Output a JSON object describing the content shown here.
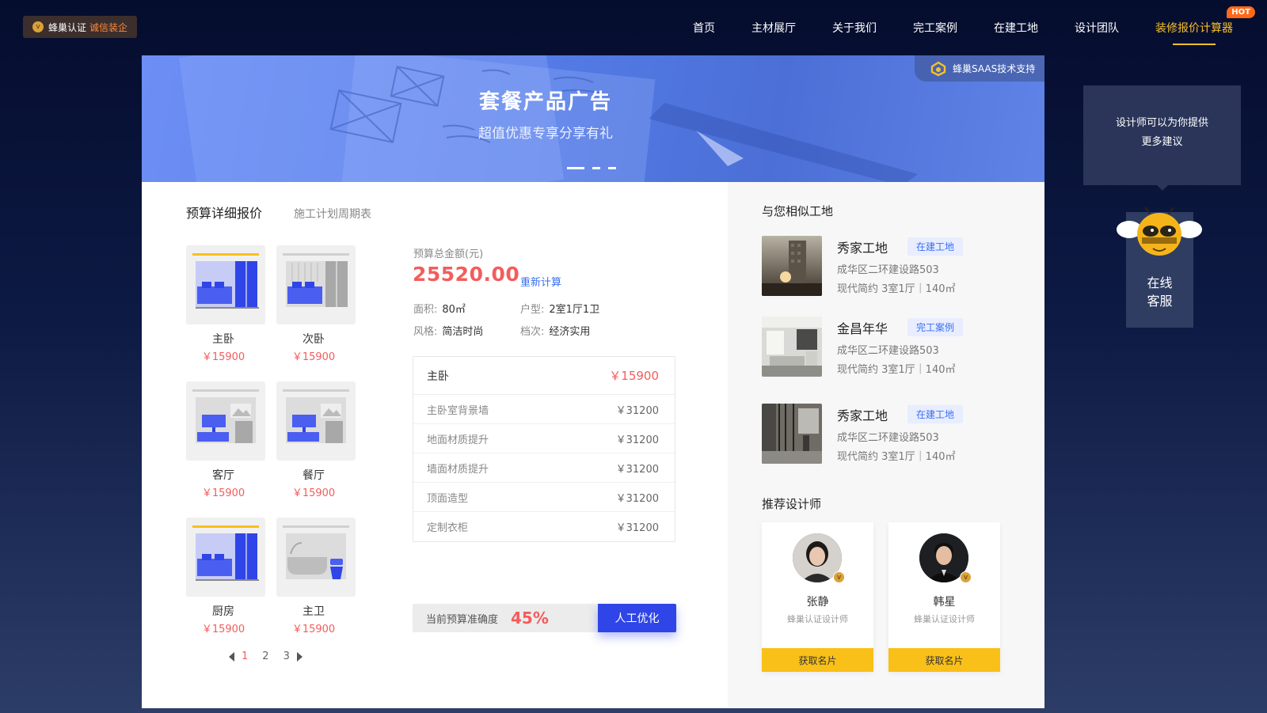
{
  "header": {
    "cert_label": "蜂巢认证",
    "cert_highlight": "诚信装企",
    "cert_icon": "v",
    "nav": [
      "首页",
      "主材展厅",
      "关于我们",
      "完工案例",
      "在建工地",
      "设计团队",
      "装修报价计算器"
    ],
    "active_nav_index": 6,
    "hot_badge": "HOT"
  },
  "banner": {
    "title": "套餐产品广告",
    "subtitle": "超值优惠专享分享有礼",
    "saas_label": "蜂巢SAAS技术支持"
  },
  "tabs": [
    "预算详细报价",
    "施工计划周期表"
  ],
  "rooms": [
    {
      "name": "主卧",
      "price": "￥15900",
      "kind": "bedroom"
    },
    {
      "name": "次卧",
      "price": "￥15900",
      "kind": "bedroom-grey"
    },
    {
      "name": "客厅",
      "price": "￥15900",
      "kind": "living"
    },
    {
      "name": "餐厅",
      "price": "￥15900",
      "kind": "living"
    },
    {
      "name": "厨房",
      "price": "￥15900",
      "kind": "bedroom"
    },
    {
      "name": "主卫",
      "price": "￥15900",
      "kind": "bath"
    }
  ],
  "pager": {
    "pages": [
      "1",
      "2",
      "3"
    ],
    "current": "1"
  },
  "budget": {
    "label": "预算总金额(元)",
    "total": "25520.00",
    "recalc": "重新计算",
    "area_key": "面积:",
    "area_val": "80㎡",
    "layout_key": "户型:",
    "layout_val": "2室1厅1卫",
    "style_key": "风格:",
    "style_val": "简洁时尚",
    "grade_key": "档次:",
    "grade_val": "经济实用"
  },
  "detail": {
    "head_name": "主卧",
    "head_price": "￥15900",
    "rows": [
      {
        "name": "主卧室背景墙",
        "price": "￥31200"
      },
      {
        "name": "地面材质提升",
        "price": "￥31200"
      },
      {
        "name": "墙面材质提升",
        "price": "￥31200"
      },
      {
        "name": "顶面造型",
        "price": "￥31200"
      },
      {
        "name": "定制衣柜",
        "price": "￥31200"
      }
    ]
  },
  "accuracy": {
    "label": "当前预算准确度",
    "value": "45%",
    "button": "人工优化"
  },
  "similar": {
    "title": "与您相似工地",
    "items": [
      {
        "name": "秀家工地",
        "tag": "在建工地",
        "addr": "成华区二环建设路503",
        "meta": "现代简约   3室1厅｜140㎡"
      },
      {
        "name": "金昌年华",
        "tag": "完工案例",
        "addr": "成华区二环建设路503",
        "meta": "现代简约   3室1厅｜140㎡"
      },
      {
        "name": "秀家工地",
        "tag": "在建工地",
        "addr": "成华区二环建设路503",
        "meta": "现代简约   3室1厅｜140㎡"
      }
    ]
  },
  "designers": {
    "title": "推荐设计师",
    "items": [
      {
        "name": "张静",
        "title": "蜂巢认证设计师",
        "button": "获取名片"
      },
      {
        "name": "韩星",
        "title": "蜂巢认证设计师",
        "button": "获取名片"
      }
    ]
  },
  "float": {
    "tip_line1": "设计师可以为你提供",
    "tip_line2": "更多建议",
    "cs_line1": "在线",
    "cs_line2": "客服"
  },
  "colors": {
    "accent": "#f7c02a",
    "price": "#f45c5c",
    "primary": "#2f45e8",
    "link": "#3a6ff2"
  }
}
